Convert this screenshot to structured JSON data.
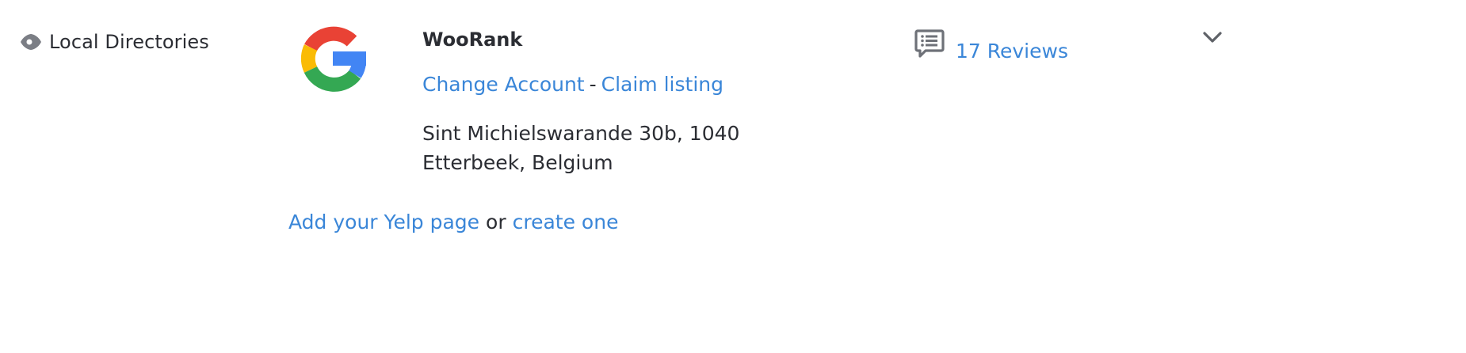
{
  "section": {
    "title": "Local Directories",
    "icon": "eye-icon"
  },
  "listing": {
    "provider_icon": "google-logo-icon",
    "name": "WooRank",
    "change_account_label": "Change Account",
    "separator": "-",
    "claim_listing_label": "Claim listing",
    "address": "Sint Michielswarande 30b, 1040 Etterbeek, Belgium",
    "reviews_icon": "comment-list-icon",
    "reviews_label": "17 Reviews"
  },
  "yelp": {
    "add_label": "Add your Yelp page",
    "or_text": "or",
    "create_label": "create one"
  },
  "expand_icon": "chevron-down-icon",
  "colors": {
    "link": "#3a86d8",
    "text": "#2b2d33",
    "icon_gray": "#7b7e85",
    "google_red": "#e94235",
    "google_yellow": "#fabb05",
    "google_green": "#34a853",
    "google_blue": "#4285f4"
  }
}
